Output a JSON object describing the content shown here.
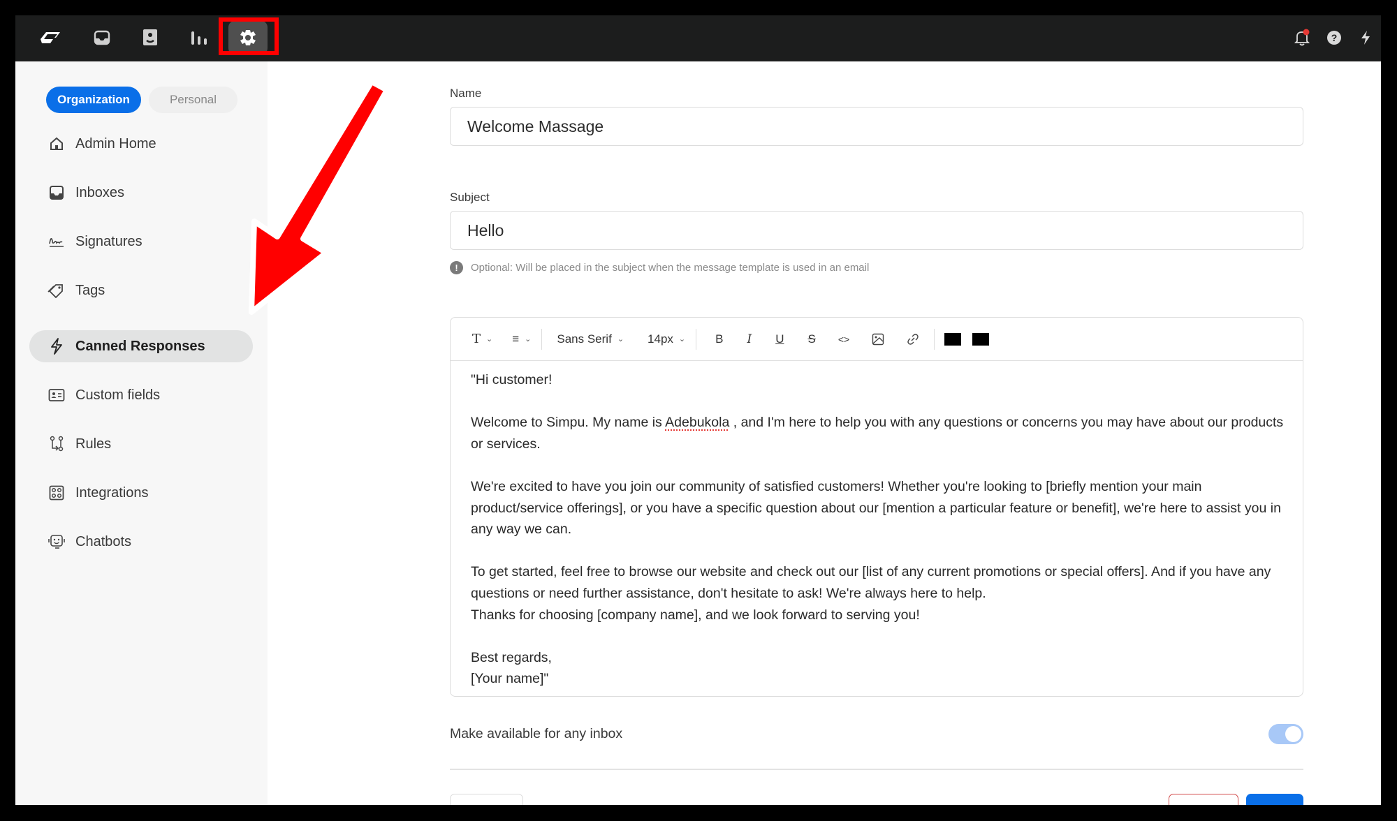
{
  "topbar": {
    "icons": [
      {
        "name": "logo-icon"
      },
      {
        "name": "inbox-icon"
      },
      {
        "name": "contacts-icon"
      },
      {
        "name": "analytics-icon"
      },
      {
        "name": "settings-icon",
        "active": true
      }
    ],
    "right_icons": [
      {
        "name": "notification-bell-icon",
        "badge": true
      },
      {
        "name": "help-icon"
      },
      {
        "name": "lightning-icon"
      }
    ]
  },
  "sidebar": {
    "scope_tabs": [
      {
        "label": "Organization",
        "active": true
      },
      {
        "label": "Personal",
        "active": false
      }
    ],
    "items": [
      {
        "label": "Admin Home",
        "icon": "home-icon"
      },
      {
        "label": "Inboxes",
        "icon": "inbox-icon"
      },
      {
        "label": "Signatures",
        "icon": "signature-icon"
      },
      {
        "label": "Tags",
        "icon": "tag-icon"
      },
      {
        "label": "Canned Responses",
        "icon": "lightning-icon",
        "active": true
      },
      {
        "label": "Custom fields",
        "icon": "id-card-icon"
      },
      {
        "label": "Rules",
        "icon": "rules-icon"
      },
      {
        "label": "Integrations",
        "icon": "integrations-icon"
      },
      {
        "label": "Chatbots",
        "icon": "chatbot-icon"
      }
    ]
  },
  "form": {
    "name_label": "Name",
    "name_value": "Welcome Massage",
    "subject_label": "Subject",
    "subject_value": "Hello",
    "subject_hint": "Optional: Will be placed in the subject when the message template is used in an email",
    "hint_icon": "!",
    "toolbar": {
      "heading": "T",
      "align": "≡",
      "font": "Sans Serif",
      "size": "14px",
      "bold": "B",
      "italic": "I",
      "underline": "U",
      "strike": "S",
      "code": "<>",
      "text_color": "#000000",
      "bg_color": "#000000"
    },
    "body": {
      "p1": "\"Hi customer!",
      "p2_before": "Welcome to Simpu. My name is ",
      "p2_name": "Adebukola",
      "p2_after": " , and I'm here to help you with any questions or concerns you may have about our products or services.",
      "p3": "We're excited to have you join our community of satisfied customers! Whether you're looking to [briefly mention your main product/service offerings], or you have a specific question about our [mention a particular feature or benefit], we're here to assist you in any way we can.",
      "p4": "To get started, feel free to browse our website and check out our [list of any current promotions or special offers]. And if you have any questions or need further assistance, don't hesitate to ask! We're always here to help.",
      "p5": "Thanks for choosing [company name], and we look forward to serving you!",
      "p6": "Best regards,",
      "p7": "[Your name]\""
    },
    "availability_label": "Make available for any inbox",
    "availability_on": true
  },
  "colors": {
    "brand": "#0a6fe8",
    "topbar": "#1c1d1d",
    "annotation": "#ff0000"
  }
}
